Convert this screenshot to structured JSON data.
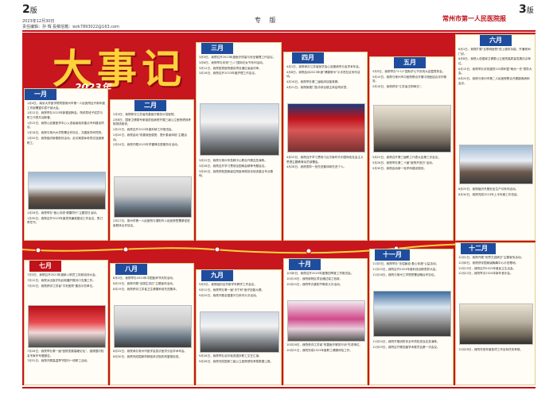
{
  "header": {
    "left_page_number": "2",
    "left_page_suffix": "版",
    "right_page_number": "3",
    "right_page_suffix": "版",
    "meta_line1": "2023年12月30日",
    "meta_line2": "责任编辑：孙 辉  投稿信箱：wzk7893022@163.com",
    "section": "专 版",
    "masthead": "常州市第一人民医院报"
  },
  "title": {
    "main": "大事记",
    "year": "2023年"
  },
  "months": {
    "jan": {
      "label": "一月",
      "entries": [
        "1月4日，南京大学医学院附属常州市第一人民医院召开新年度工作部署暨中层干部大会。",
        "1月12日，我院举办2023年新春团拜会，院领导班子成员与职工代表共迎新春。",
        "1月15日，我院心血管医学中心入选省级临床重点专科建设项目。",
        "1月18日，我院与常州大学签署合作协议，共建医学研究院。",
        "1月20日，我院组织新春慰问活动，走访离退休老同志及困难职工。"
      ],
      "entries2": [
        "1月28日，我院举办\"医心向党·健康同行\"主题党日活动。",
        "1月30日，我院召开2023年度党风廉政建设工作会议，签订责任书。"
      ]
    },
    "feb": {
      "label": "二月",
      "entries": [
        "2月3日，我院获评江苏省改善医疗服务示范医院。",
        "2月8日，国家卫健委专家组莅临我院开展三级公立医院绩效考核现场核查。",
        "2月15日，我院召开2023年度科研工作推进会。",
        "2月20日，我院启动\"改善就医感受、提升患者体验\"主题活动。",
        "2月24日，我院开展2023年学雷锋志愿服务月活动。"
      ],
      "entries2": [
        "2月27日，常州市第一人民医院与溧阳市人民医院签署紧密型医联体合作协议。"
      ]
    },
    "mar": {
      "label": "三月",
      "entries": [
        "3月3日，我院召开2023年度医疗质量与安全管理工作会议。",
        "3月8日，我院举办庆祝\"三八\"国际妇女节系列活动。",
        "3月12日，我院智慧医院建设项目通过省级评审。",
        "3月16日，我院召开2023年度护理工作会议。"
      ],
      "entries2": [
        "3月22日，我院与常州市急救中心联合开展应急演练。",
        "3月28日，我院召开学习贯彻全国两会精神专题会议。",
        "3月30日，我院获批国家级住院医师规范化培训重点专业基地。"
      ]
    },
    "apr": {
      "label": "四月",
      "entries": [
        "4月1日，我院承办江苏省医学会心血管病学分会学术年会。",
        "4月8日，我院启动2023年度\"健康常州\"义诊进社区系列活动。",
        "4月16日，我院举办第二届临床技能竞赛。",
        "4月21日，我院新建门急诊综合楼主体结构封顶。"
      ],
      "entries2": [
        "4月25日，我院召开学习贯彻习近平新时代中国特色社会主义思想主题教育动员部署会。",
        "4月28日，我院表彰一批先进集体和先进个人。"
      ]
    },
    "may": {
      "label": "五月",
      "entries": [
        "5月5日，我院举办\"5·12\"国际护士节庆祝大会暨表彰会。",
        "5月10日，我院与常州市中医院联合开展中西医结合诊疗服务。",
        "5月18日，我院获评\"江苏省文明单位\"。"
      ],
      "entries2": [
        "5月22日，我院召开第三届职工代表大会第三次会议。",
        "5月26日，我院举办第二十届\"医院开放日\"活动。",
        "5月30日，我院启动新一轮学科建设规划。"
      ]
    },
    "jun": {
      "label": "六月",
      "entries": [
        "6月1日，我院扩展\"互联网医院\"线上服务功能，开通夜间门诊。",
        "6月8日，我院入选国家卫健委公立医院高质量发展试点单位。",
        "6月15日，我院举办庆祝建党102周年暨\"两优一先\"表彰大会。",
        "6月20日，我院与常州市第二人民医院联合开展疑难病例会诊。"
      ],
      "entries2": [
        "6月25日，我院组织开展安全生产月系列活动。",
        "6月30日，我院完成2023年上半年度工作总结。"
      ]
    },
    "jul": {
      "label": "七月",
      "entries": [
        "7月3日，我院召开2023年度新入职员工岗前培训大会。",
        "7月12日，我院派出医疗队赴新疆开展对口支援工作。",
        "7月20日，我院获评江苏省\"平安医院\"建设示范单位。"
      ],
      "entries2": [
        "7月26日，我院举办第一届\"医院发展高峰论坛\"，邀请国内知名专家作专题报告。",
        "7月31日，我院开展高温季节慰问一线职工活动。"
      ]
    },
    "aug": {
      "label": "八月",
      "entries": [
        "8月2日，我院举办2023年中国医师节庆祝活动。",
        "8月15日，我院开展\"全国生态日\"主题宣传活动。",
        "8月19日，我院获评江苏省卫生健康系统先进集体。"
      ],
      "entries2": [
        "8月25日，我院承办常州市医学会急诊医学分会学术年会。",
        "8月30日，我院完成国家药物临床试验机构复核检查。"
      ]
    },
    "sep": {
      "label": "九月",
      "entries": [
        "9月5日，我院组织召开新学年教学工作会议。",
        "9月12日，我院举办第一届\"天宁杯\"医疗技能大赛。",
        "9月20日，我院开展全国爱牙日系列义诊活动。"
      ],
      "entries2": [
        "9月26日，我院举办迎中秋庆国庆职工文艺汇演。",
        "9月28日，我院完成国家三级公立医院绩效考核数据上报。"
      ]
    },
    "oct": {
      "label": "十月",
      "entries": [
        "10月8日，我院召开2023年度第四季度工作推进会。",
        "10月16日，我院新院区项目通过竣工验收。",
        "10月24日，我院举办重阳节敬老义诊活动。"
      ],
      "entries2": [
        "10月28日，我院获评江苏省\"改善医疗服务行动\"先进单位。",
        "10月31日，我院完成2023年度职工健康体检工作。"
      ]
    },
    "nov": {
      "label": "十一月",
      "entries": [
        "11月3日，我院举办\"无偿献血·爱心传递\"公益活动。",
        "11月10日，我院召开2023年度科技创新表彰大会。",
        "11月18日，我院与常州工学院签署战略合作协议。"
      ],
      "entries2": [
        "11月24日，我院开展消防安全专项检查及应急演练。",
        "11月29日，我院召开第四届学术委员会第一次会议。"
      ]
    },
    "dec": {
      "label": "十二月",
      "entries": [
        "12月1日，我院开展\"世界艾滋病日\"主题宣传活动。",
        "12月8日，我院获评国家级胸痛中心示范基地。",
        "12月15日，我院召开2023年度民主生活会。",
        "12月22日，我院举办2024年新年音乐会。"
      ],
      "entries2": [
        "12月28日，我院完成年度各项工作目标任务考核。"
      ]
    }
  },
  "colors": {
    "poster_red": "#c7161d",
    "title_yellow": "#ffd23c",
    "tab_blue": "#1f4d9e",
    "tab_red": "#c0121a"
  }
}
